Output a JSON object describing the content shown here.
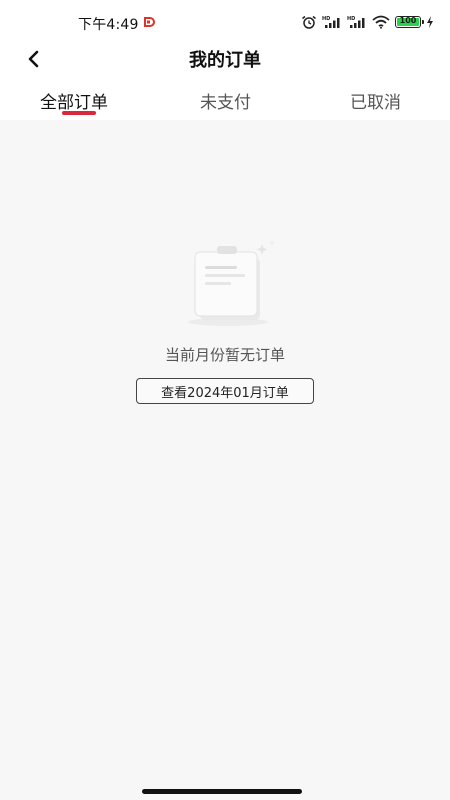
{
  "status_bar": {
    "time": "下午4:49",
    "battery_level": "100",
    "battery_color": "#2bd14b",
    "icons": [
      "app-badge-icon",
      "alarm-icon",
      "hd-signal-icon",
      "hd-signal-icon",
      "wifi-icon",
      "battery-icon",
      "charging-icon"
    ]
  },
  "header": {
    "title": "我的订单",
    "back_icon": "chevron-left-icon"
  },
  "tabs": [
    {
      "label": "全部订单",
      "active": true
    },
    {
      "label": "未支付",
      "active": false
    },
    {
      "label": "已取消",
      "active": false
    }
  ],
  "accent_color": "#d9283b",
  "empty_state": {
    "icon": "empty-clipboard-icon",
    "message": "当前月份暂无订单",
    "button_label": "查看2024年01月订单"
  }
}
